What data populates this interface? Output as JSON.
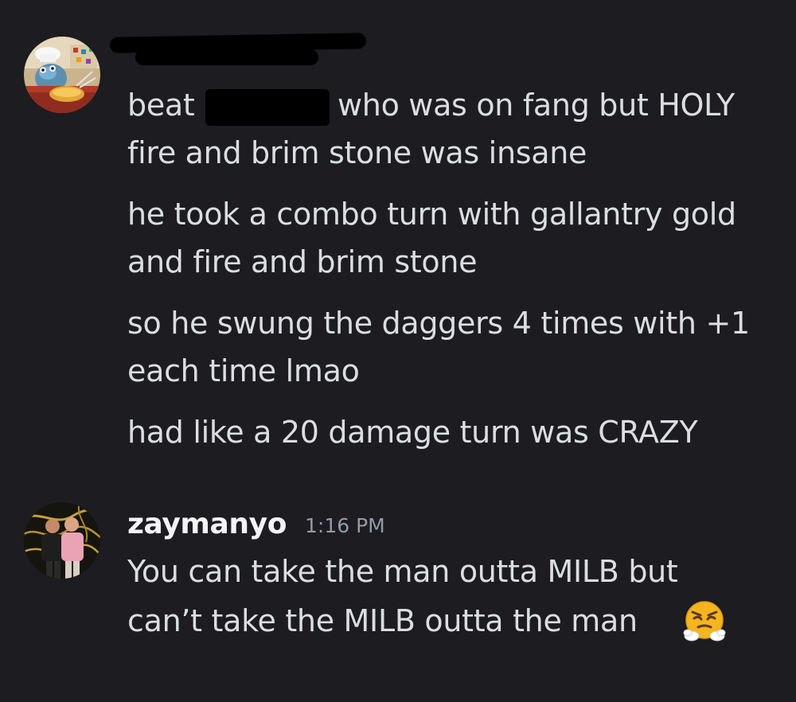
{
  "messages": [
    {
      "author": {
        "name": "",
        "name_redacted": true,
        "avatar": "chef-figure-avatar"
      },
      "lines": [
        {
          "prefix": "beat",
          "suffix": "who was on fang but HOLY"
        },
        "fire and brim stone was insane",
        "he took a combo turn with gallantry gold",
        "and fire and brim stone",
        "so he swung the daggers 4 times with +1",
        "each time lmao",
        "had like a 20 damage turn was CRAZY"
      ]
    },
    {
      "author": {
        "name": "zaymanyo",
        "avatar": "two-people-photo-avatar"
      },
      "timestamp": "1:16 PM",
      "lines": [
        "You can take the man outta MILB but",
        "can’t take the MILB outta the man"
      ],
      "emoji": "face-with-steam-from-nose-emoji"
    }
  ],
  "colors": {
    "background": "#1c1c21",
    "message_text": "#dbdee1",
    "username": "#f2f3f5",
    "timestamp": "#949ba4",
    "redaction": "#000000"
  }
}
